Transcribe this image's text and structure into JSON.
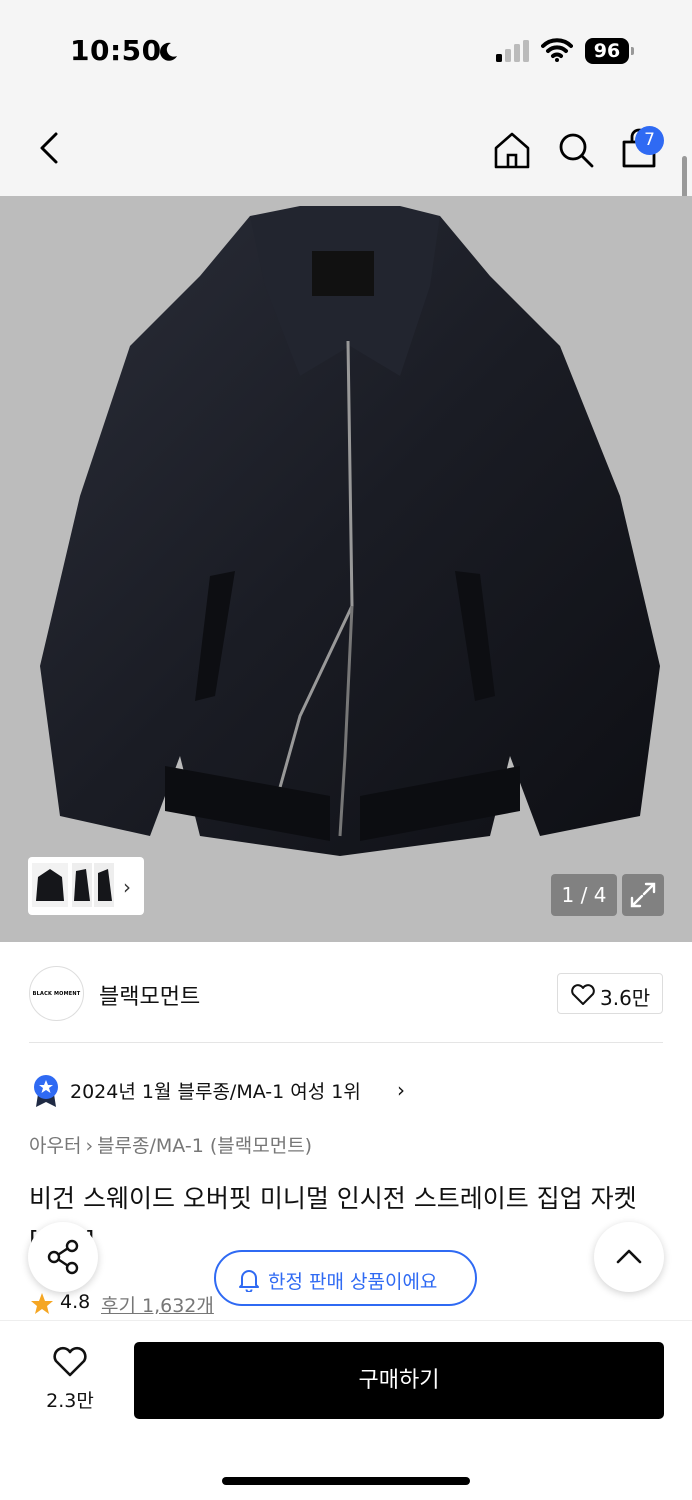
{
  "status_bar": {
    "time": "10:50",
    "battery": "96"
  },
  "nav": {
    "cart_count": "7"
  },
  "gallery": {
    "counter": "1 / 4"
  },
  "brand": {
    "logo_text": "BLACK MOMENT",
    "name": "블랙모먼트",
    "likes": "3.6만"
  },
  "ranking": {
    "text": "2024년 1월 블루종/MA-1 여성 1위"
  },
  "breadcrumb": {
    "category": "아우터",
    "sub_category": "블루종/MA-1 (블랙모먼트)"
  },
  "product": {
    "title": "비건 스웨이드 오버핏 미니멀 인시전 스트레이트 집업 자켓 [블랙]"
  },
  "rating": {
    "score": "4.8",
    "reviews": "후기 1,632개"
  },
  "notice": {
    "limited": "한정 판매 상품이에요"
  },
  "bottom_bar": {
    "wish_count": "2.3만",
    "buy_label": "구매하기"
  },
  "colors": {
    "accent": "#2f6af3",
    "star": "#f5a623",
    "buy_button": "#000000"
  }
}
